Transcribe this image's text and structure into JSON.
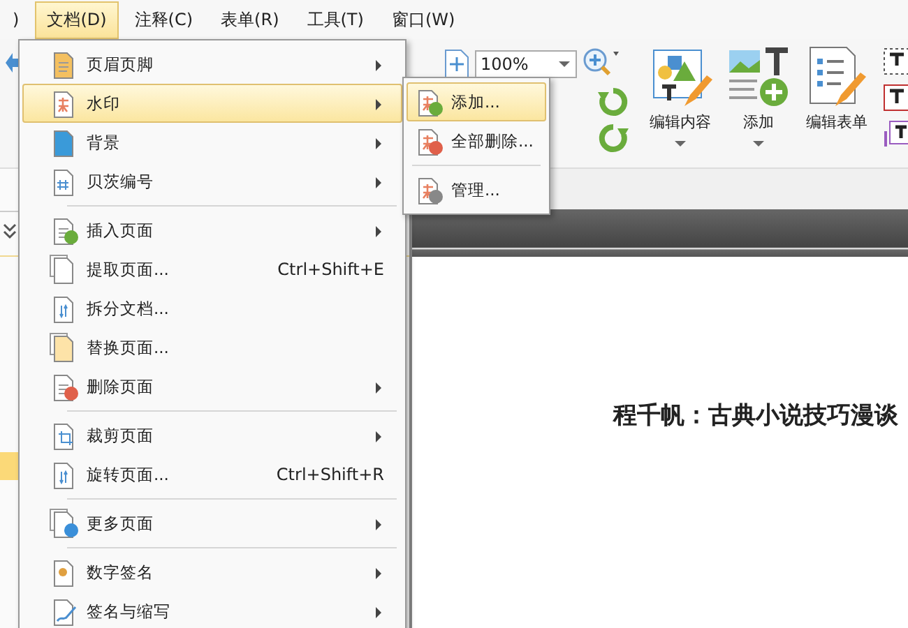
{
  "menu_bar": [
    {
      "label": ")",
      "selected": false
    },
    {
      "label": "文档(D)",
      "selected": true
    },
    {
      "label": "注释(C)",
      "selected": false
    },
    {
      "label": "表单(R)",
      "selected": false
    },
    {
      "label": "工具(T)",
      "selected": false
    },
    {
      "label": "窗口(W)",
      "selected": false
    }
  ],
  "toolbar": {
    "zoom_value": "100%",
    "big_buttons": [
      {
        "label": "编辑内容",
        "kind": "edit-content",
        "dropdown": true
      },
      {
        "label": "添加",
        "kind": "add",
        "dropdown": true
      },
      {
        "label": "编辑表单",
        "kind": "edit-form",
        "dropdown": false
      }
    ]
  },
  "document_menu": {
    "groups": [
      [
        {
          "label": "页眉页脚",
          "kind": "header",
          "submenu": true,
          "highlighted": false
        },
        {
          "label": "水印",
          "kind": "watermark",
          "submenu": true,
          "highlighted": true
        },
        {
          "label": "背景",
          "kind": "background",
          "submenu": true,
          "highlighted": false
        },
        {
          "label": "贝茨编号",
          "kind": "bates",
          "submenu": true,
          "highlighted": false
        }
      ],
      [
        {
          "label": "插入页面",
          "kind": "insert",
          "submenu": true,
          "highlighted": false
        },
        {
          "label": "提取页面...",
          "kind": "extract",
          "shortcut": "Ctrl+Shift+E",
          "submenu": false,
          "highlighted": false
        },
        {
          "label": "拆分文档...",
          "kind": "split",
          "submenu": false,
          "highlighted": false
        },
        {
          "label": "替换页面...",
          "kind": "replace",
          "submenu": false,
          "highlighted": false
        },
        {
          "label": "删除页面",
          "kind": "delete",
          "submenu": true,
          "highlighted": false
        }
      ],
      [
        {
          "label": "裁剪页面",
          "kind": "crop",
          "submenu": true,
          "highlighted": false
        },
        {
          "label": "旋转页面...",
          "kind": "rotate",
          "shortcut": "Ctrl+Shift+R",
          "submenu": false,
          "highlighted": false
        }
      ],
      [
        {
          "label": "更多页面",
          "kind": "more",
          "submenu": true,
          "highlighted": false
        }
      ],
      [
        {
          "label": "数字签名",
          "kind": "certificate",
          "submenu": true,
          "highlighted": false
        },
        {
          "label": "签名与缩写",
          "kind": "sign",
          "submenu": true,
          "highlighted": false
        }
      ]
    ]
  },
  "watermark_submenu": {
    "groups": [
      [
        {
          "label": "添加...",
          "kind": "add",
          "highlighted": true
        },
        {
          "label": "全部删除...",
          "kind": "delete",
          "highlighted": false
        }
      ],
      [
        {
          "label": "管理...",
          "kind": "manage",
          "highlighted": false
        }
      ]
    ]
  },
  "page": {
    "title": "程千帆：古典小说技巧漫谈"
  }
}
